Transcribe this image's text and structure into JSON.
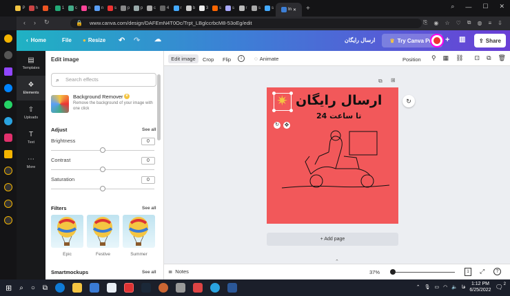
{
  "browser": {
    "tabs": [
      {
        "letter": "P",
        "color": "#f4c542"
      },
      {
        "letter": "h",
        "color": "#c44"
      },
      {
        "letter": ".",
        "color": "#ee5522"
      },
      {
        "letter": "1",
        "color": "#2a7"
      },
      {
        "letter": "c",
        "color": "#4a8"
      },
      {
        "letter": "n",
        "color": "#f49"
      },
      {
        "letter": "n",
        "color": "#5a9ff6"
      },
      {
        "letter": "s",
        "color": "#e33"
      },
      {
        "letter": "p",
        "color": "#888"
      },
      {
        "letter": "p",
        "color": "#9aa"
      },
      {
        "letter": "c",
        "color": "#aaa"
      },
      {
        "letter": "4",
        "color": "#666"
      },
      {
        "letter": "r",
        "color": "#4af"
      },
      {
        "letter": "b",
        "color": "#ccc"
      },
      {
        "letter": "3",
        "color": "#eee"
      },
      {
        "letter": "s",
        "color": "#f60"
      },
      {
        "letter": "s",
        "color": "#aaf"
      },
      {
        "letter": "r",
        "color": "#bbb"
      },
      {
        "letter": "s",
        "color": "#aaa"
      },
      {
        "letter": "s",
        "color": "#4af"
      }
    ],
    "active_tab": "In",
    "new_tab": "+",
    "url": "www.canva.com/design/DAFEmN4T0Oc/Trpt_LBglccrbcM8-53oEg/edit"
  },
  "header": {
    "home": "Home",
    "file": "File",
    "resize": "Resize",
    "design_title": "ارسال رایگان",
    "try_pro": "Try Canva Pro",
    "share": "Share"
  },
  "rail": {
    "items": [
      {
        "label": "Templates",
        "icon": "▤"
      },
      {
        "label": "Elements",
        "icon": "❖"
      },
      {
        "label": "Uploads",
        "icon": "⇧"
      },
      {
        "label": "Text",
        "icon": "T"
      },
      {
        "label": "More",
        "icon": "⋯"
      }
    ]
  },
  "panel": {
    "title": "Edit image",
    "search_placeholder": "Search effects",
    "bg_remover": {
      "title": "Background Remover",
      "desc": "Remove the background of your image with one click"
    },
    "adjust": {
      "heading": "Adjust",
      "see_all": "See all",
      "sliders": [
        {
          "label": "Brightness",
          "value": "0",
          "level": 0.5
        },
        {
          "label": "Contrast",
          "value": "0",
          "level": 0.5
        },
        {
          "label": "Saturation",
          "value": "0",
          "level": 0.5
        }
      ]
    },
    "filters": {
      "heading": "Filters",
      "see_all": "See all",
      "items": [
        "Epic",
        "Festive",
        "Summer"
      ]
    },
    "smartmockups": {
      "heading": "Smartmockups",
      "see_all": "See all"
    }
  },
  "toolbar": {
    "edit_image": "Edit image",
    "crop": "Crop",
    "flip": "Flip",
    "animate": "Animate",
    "position": "Position"
  },
  "canvas": {
    "headline": "ارسال رایگان",
    "subline": "تا ساعت 24",
    "add_page": "+ Add page",
    "bg_color": "#f2585a"
  },
  "bottom": {
    "notes": "Notes",
    "zoom": "37%",
    "page_num": "1"
  },
  "taskbar": {
    "time": "1:12 PM",
    "date": "6/25/2022",
    "lang": "فا",
    "notif": "2"
  }
}
